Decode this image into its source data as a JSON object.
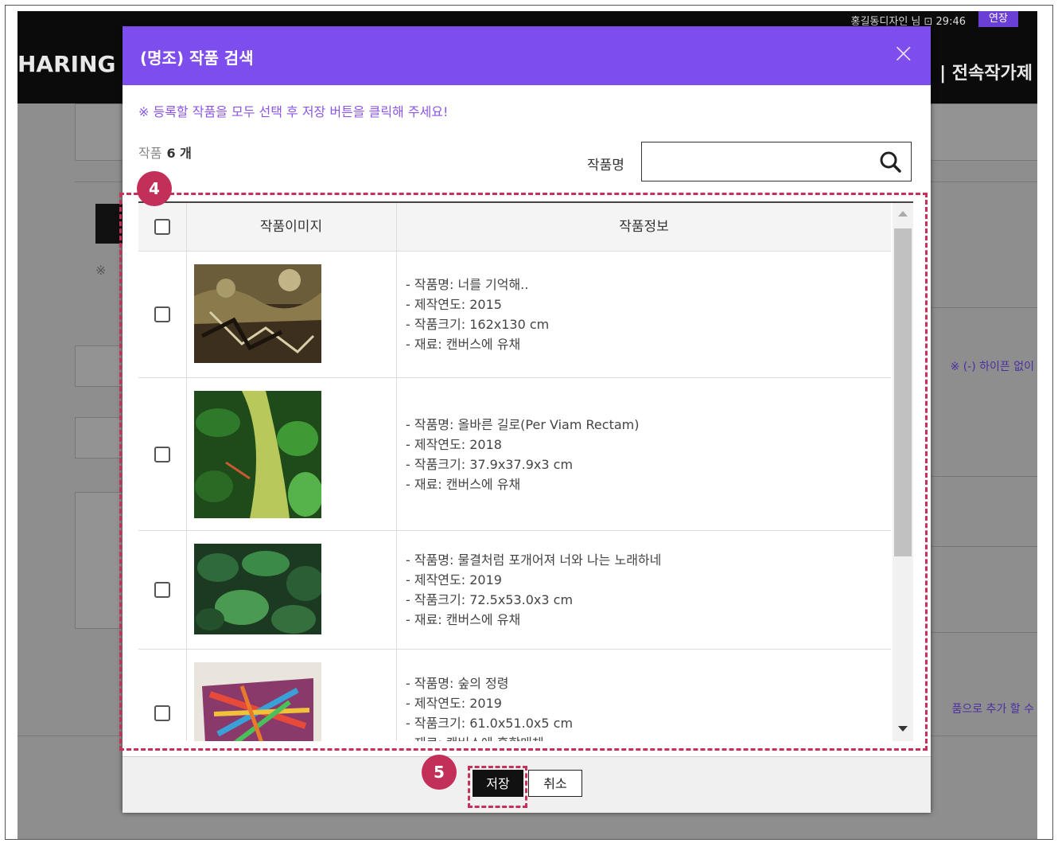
{
  "background": {
    "user_text": "홍길동디자인 님  ⊡ 29:46",
    "extend_label": "연장",
    "brand_text": "HARING",
    "right_menu_text": "| 전속작가제",
    "note1": "※ (-) 하이픈 없이",
    "note2": "품으로 추가 할 수",
    "mark": "※"
  },
  "modal": {
    "title": "(명조) 작품 검색",
    "close_icon": "×",
    "notice": "※ 등록할 작품을 모두 선택 후 저장 버튼을 클릭해 주세요!",
    "count_label": "작품",
    "count_value": "6 개",
    "search": {
      "label": "작품명",
      "value": "",
      "placeholder": ""
    },
    "table": {
      "headers": {
        "image": "작품이미지",
        "info": "작품정보"
      },
      "rows": [
        {
          "name": "- 작품명: 너를 기억해..",
          "year": "- 제작연도: 2015",
          "size": "- 작품크기: 162x130 cm",
          "material": "- 재료: 캔버스에 유채",
          "checked": false
        },
        {
          "name": "- 작품명: 올바른 길로(Per Viam Rectam)",
          "year": "- 제작연도: 2018",
          "size": "- 작품크기: 37.9x37.9x3 cm",
          "material": "- 재료: 캔버스에 유채",
          "checked": false
        },
        {
          "name": "- 작품명: 물결처럼 포개어져 너와 나는 노래하네",
          "year": "- 제작연도: 2019",
          "size": "- 작품크기: 72.5x53.0x3 cm",
          "material": "- 재료: 캔버스에 유채",
          "checked": false
        },
        {
          "name": "- 작품명: 숲의 정령",
          "year": "- 제작연도: 2019",
          "size": "- 작품크기: 61.0x51.0x5 cm",
          "material": "- 재료: 캔버스에 혼합매체",
          "checked": false
        }
      ]
    },
    "buttons": {
      "save": "저장",
      "cancel": "취소"
    }
  },
  "annotations": {
    "badge4": "4",
    "badge5": "5"
  },
  "colors": {
    "header": "#7e4ded",
    "notice": "#8b56e8",
    "highlight": "#c5315b"
  }
}
